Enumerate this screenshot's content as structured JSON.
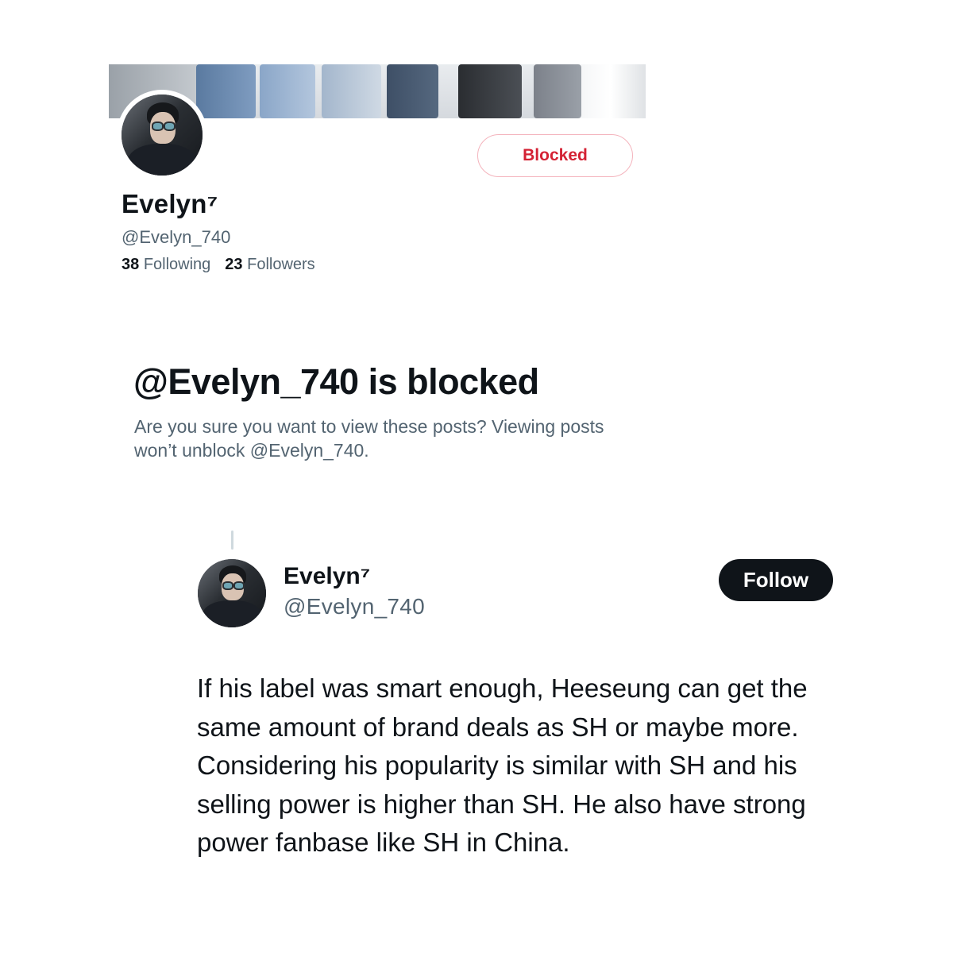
{
  "profile": {
    "banner_alt": "",
    "name": "Evelyn⁷",
    "handle": "@Evelyn_740",
    "following_count": "38",
    "following_label": "Following",
    "followers_count": "23",
    "followers_label": "Followers",
    "blocked_button_label": "Blocked"
  },
  "blocked_notice": {
    "title": "@Evelyn_740 is blocked",
    "text": "Are you sure you want to view these posts? Viewing posts won’t unblock @Evelyn_740."
  },
  "tweet": {
    "name": "Evelyn⁷",
    "handle": "@Evelyn_740",
    "follow_label": "Follow",
    "text": "If his label was smart enough, Heeseung can get the same amount of brand deals as SH or maybe more. Considering his popularity is similar with SH and his selling power is higher than SH. He also have strong power fanbase like SH in China."
  },
  "colors": {
    "blocked_red": "#d42234",
    "blocked_border": "#f4b4bd",
    "secondary_text": "#536471",
    "primary_text": "#0f1419",
    "follow_bg": "#0f1419"
  }
}
